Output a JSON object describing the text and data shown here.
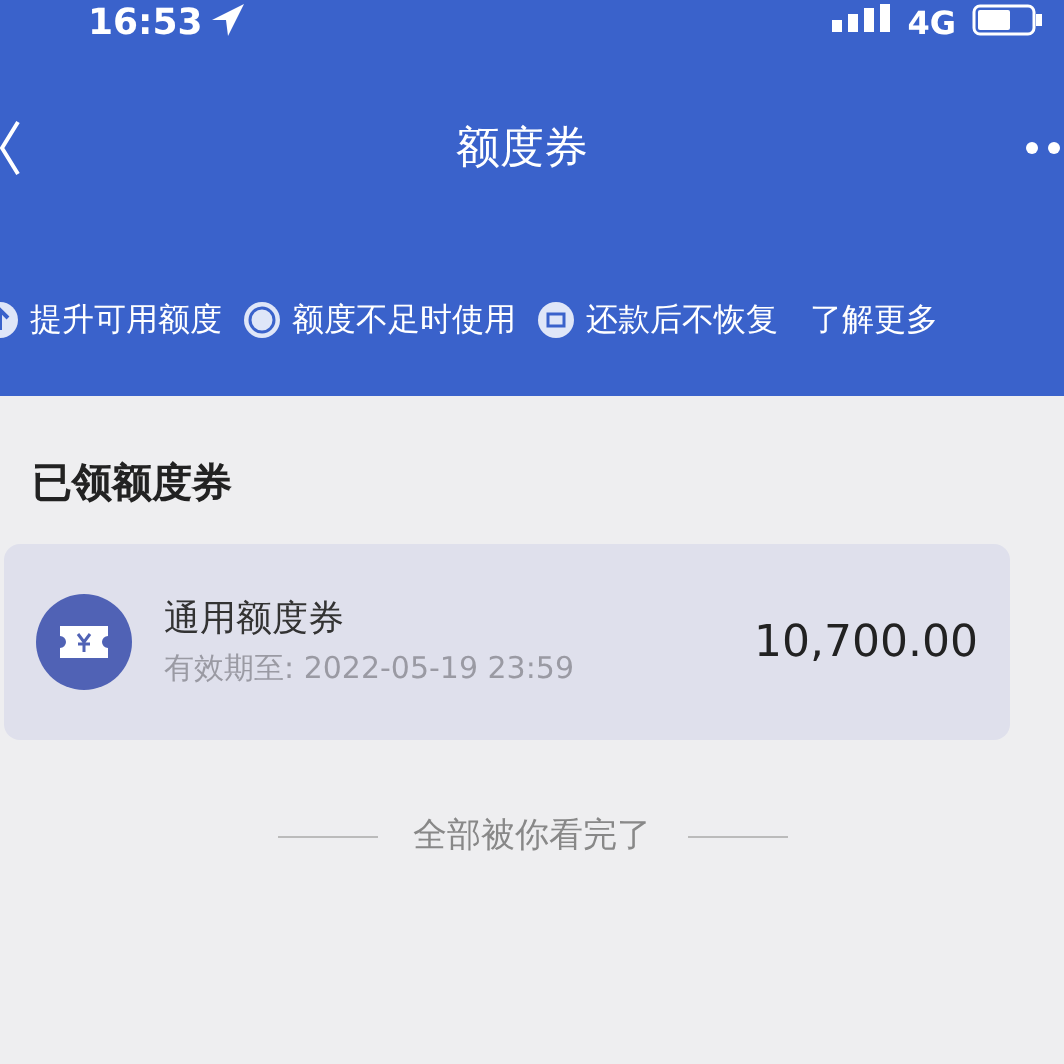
{
  "status_bar": {
    "time": "16:53",
    "network": "4G"
  },
  "nav_bar": {
    "title": "额度券"
  },
  "features": [
    {
      "label": "提升可用额度"
    },
    {
      "label": "额度不足时使用"
    },
    {
      "label": "还款后不恢复"
    }
  ],
  "learn_more": "了解更多",
  "section_title": "已领额度券",
  "coupons": [
    {
      "name": "通用额度券",
      "expiry": "有效期至: 2022-05-19 23:59",
      "amount": "10,700.00"
    }
  ],
  "end_note": "全部被你看完了"
}
